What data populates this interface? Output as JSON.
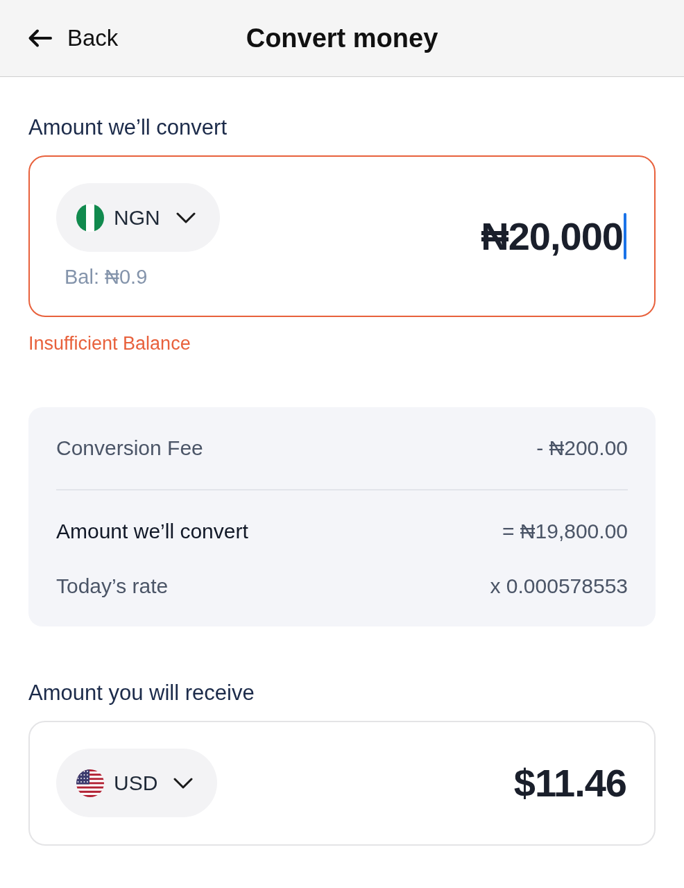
{
  "header": {
    "back": "Back",
    "title": "Convert money"
  },
  "send": {
    "label": "Amount we’ll convert",
    "currency": "NGN",
    "flag": {
      "kind": "ng"
    },
    "balance": "Bal: ₦0.9",
    "amount": "₦20,000",
    "focused": true,
    "error": "Insufficient Balance"
  },
  "summary": {
    "fees": [
      {
        "label": "Conversion Fee",
        "value": "- ₦200.00",
        "emphasis": false
      }
    ],
    "conversion": [
      {
        "label": "Amount we’ll convert",
        "value": "= ₦19,800.00",
        "emphasis": true
      },
      {
        "label": "Today’s rate",
        "value": "x 0.000578553",
        "emphasis": false
      }
    ]
  },
  "receive": {
    "label": "Amount you will receive",
    "currency": "USD",
    "flag": {
      "kind": "us"
    },
    "amount": "$11.46"
  }
}
